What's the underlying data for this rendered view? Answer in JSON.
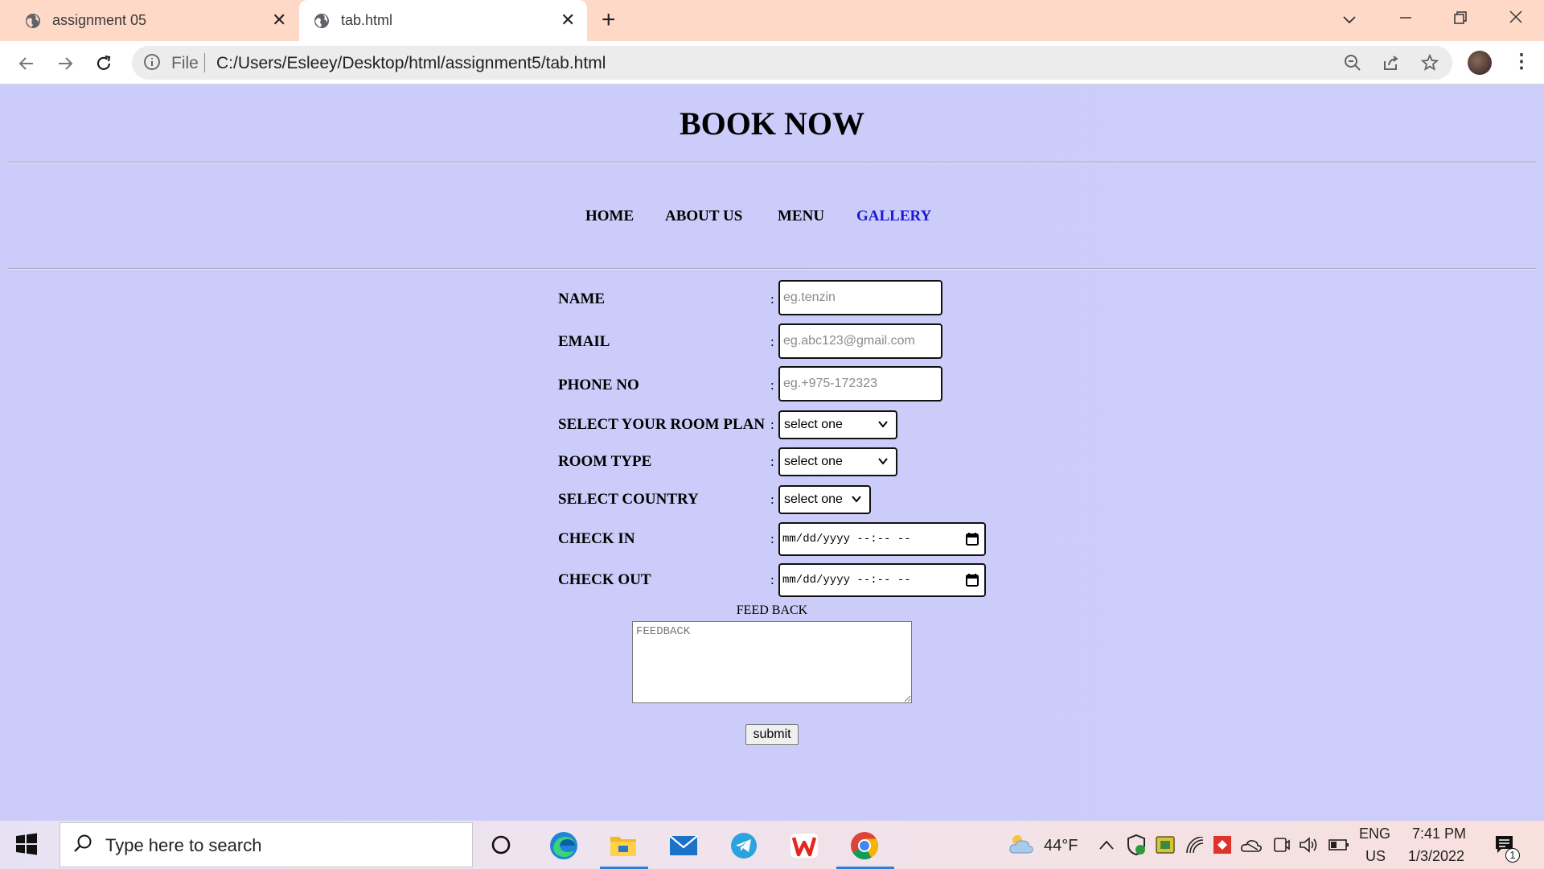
{
  "browser": {
    "tabs": [
      {
        "title": "assignment 05",
        "active": false
      },
      {
        "title": "tab.html",
        "active": true
      }
    ],
    "address_prefix": "File",
    "url": "C:/Users/Esleey/Desktop/html/assignment5/tab.html"
  },
  "page": {
    "heading": "BOOK NOW",
    "menu": [
      "HOME",
      "ABOUT US",
      "MENU",
      "GALLERY"
    ],
    "form": {
      "colon": ":",
      "name": {
        "label": "NAME",
        "placeholder": "eg.tenzin"
      },
      "email": {
        "label": "EMAIL",
        "placeholder": "eg.abc123@gmail.com"
      },
      "phone": {
        "label": "PHONE NO",
        "placeholder": "eg.+975-172323"
      },
      "room_plan": {
        "label": "SELECT YOUR ROOM PLAN",
        "value": "select one"
      },
      "room_type": {
        "label": "ROOM TYPE",
        "value": "select one"
      },
      "country": {
        "label": "SELECT COUNTRY",
        "value": "select one"
      },
      "check_in": {
        "label": "CHECK IN",
        "value": "mm/dd/yyyy --:-- --"
      },
      "check_out": {
        "label": "CHECK OUT",
        "value": "mm/dd/yyyy --:-- --"
      },
      "feedback_label": "FEED BACK",
      "feedback_placeholder": "FEEDBACK",
      "submit": "submit"
    }
  },
  "taskbar": {
    "search_placeholder": "Type here to search",
    "weather": "44°F",
    "lang_top": "ENG",
    "lang_bottom": "US",
    "time": "7:41 PM",
    "date": "1/3/2022",
    "notifications": "1",
    "apps": [
      "start-icon",
      "search-icon",
      "cortana-icon",
      "edge-icon",
      "file-explorer-icon",
      "mail-icon",
      "telegram-icon",
      "wps-office-icon",
      "chrome-icon"
    ]
  }
}
